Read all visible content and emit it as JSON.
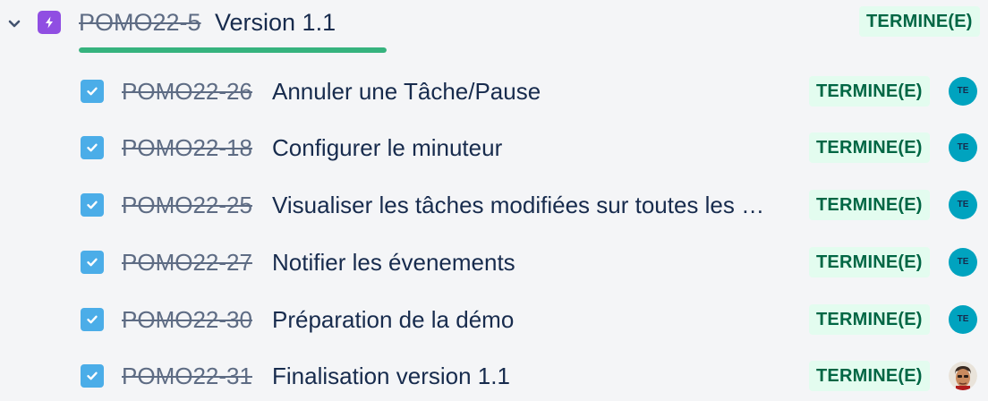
{
  "epic": {
    "key": "POMO22-5",
    "title": "Version 1.1",
    "status": "TERMINE(E)",
    "progress": 1.0,
    "icon": "lightning-bolt-icon",
    "colors": {
      "icon_bg": "#904ee2",
      "progress": "#36b37e"
    }
  },
  "children": [
    {
      "key": "POMO22-26",
      "summary": "Annuler une Tâche/Pause",
      "status": "TERMINE(E)",
      "assignee": "TE",
      "avatar_type": "initials"
    },
    {
      "key": "POMO22-18",
      "summary": "Configurer le minuteur",
      "status": "TERMINE(E)",
      "assignee": "TE",
      "avatar_type": "initials"
    },
    {
      "key": "POMO22-25",
      "summary": "Visualiser les tâches modifiées sur toutes les …",
      "status": "TERMINE(E)",
      "assignee": "TE",
      "avatar_type": "initials"
    },
    {
      "key": "POMO22-27",
      "summary": "Notifier les évenements",
      "status": "TERMINE(E)",
      "assignee": "TE",
      "avatar_type": "initials"
    },
    {
      "key": "POMO22-30",
      "summary": "Préparation de la démo",
      "status": "TERMINE(E)",
      "assignee": "TE",
      "avatar_type": "initials"
    },
    {
      "key": "POMO22-31",
      "summary": "Finalisation version 1.1",
      "status": "TERMINE(E)",
      "assignee": "",
      "avatar_type": "photo"
    }
  ],
  "colors": {
    "status_bg": "#e3fcef",
    "status_text": "#006644",
    "checkbox": "#4bade8",
    "avatar": "#00a3bf"
  }
}
